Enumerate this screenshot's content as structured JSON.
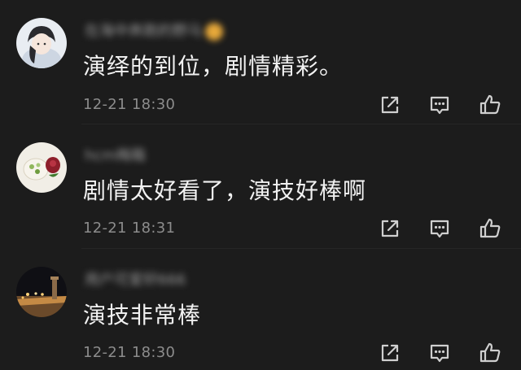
{
  "comments": [
    {
      "username": "在海中奔跑的野马",
      "text": "演绎的到位，剧情精彩。",
      "time": "12-21 18:30"
    },
    {
      "username": "hcm梅箱",
      "text": "剧情太好看了，演技好棒啊",
      "time": "12-21 18:31"
    },
    {
      "username": "用户可爱轩666",
      "text": "演技非常棒",
      "time": "12-21 18:30"
    }
  ],
  "colors": {
    "background": "#1c1c1c",
    "text": "#f2f2f2",
    "muted": "#8c8c8c",
    "icon": "#cfcfcf",
    "badge": "#e6a83a"
  },
  "icons": [
    "share-icon",
    "comment-icon",
    "thumbs-up-icon"
  ]
}
